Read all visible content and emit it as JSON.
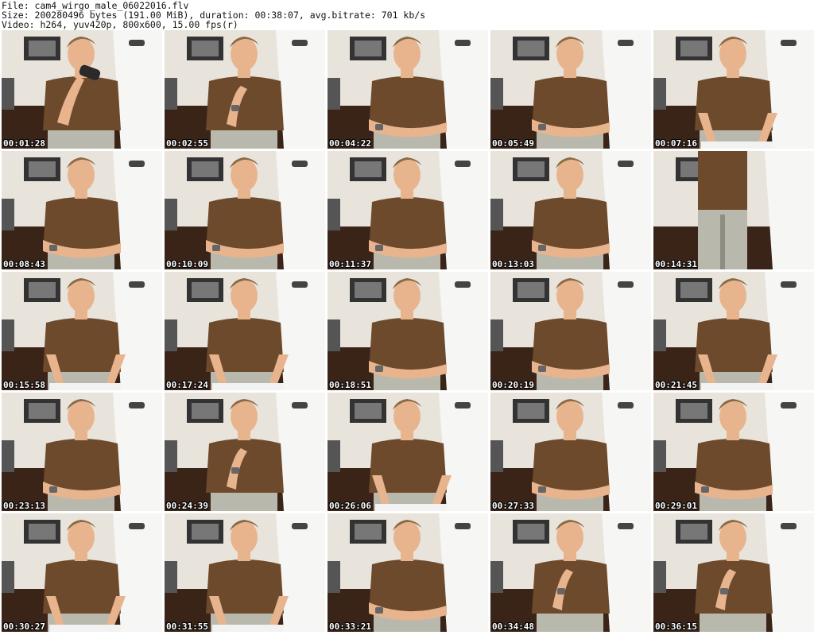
{
  "header": {
    "file_line": "File: cam4_wirgo_male_06022016.flv",
    "size_line": "Size: 200280496 bytes (191.00 MiB), duration: 00:38:07, avg.bitrate: 701 kb/s",
    "video_line": "Video: h264, yuv420p, 800x600, 15.00 fps(r)"
  },
  "colors": {
    "shirt": "#6e4a2c",
    "skin": "#e8b48e",
    "hair": "#8a6a44",
    "floor": "#3a2418",
    "wall": "#e8e4dc",
    "jeans": "#b9b8ad"
  },
  "thumbnails": [
    {
      "time": "00:01:28",
      "pose": "drinking"
    },
    {
      "time": "00:02:55",
      "pose": "hand-chin"
    },
    {
      "time": "00:04:22",
      "pose": "arms-crossed"
    },
    {
      "time": "00:05:49",
      "pose": "arms-crossed"
    },
    {
      "time": "00:07:16",
      "pose": "typing"
    },
    {
      "time": "00:08:43",
      "pose": "arms-crossed"
    },
    {
      "time": "00:10:09",
      "pose": "arms-crossed"
    },
    {
      "time": "00:11:37",
      "pose": "arms-crossed"
    },
    {
      "time": "00:13:03",
      "pose": "arms-crossed"
    },
    {
      "time": "00:14:31",
      "pose": "standing"
    },
    {
      "time": "00:15:58",
      "pose": "typing"
    },
    {
      "time": "00:17:24",
      "pose": "typing"
    },
    {
      "time": "00:18:51",
      "pose": "arms-crossed"
    },
    {
      "time": "00:20:19",
      "pose": "arms-crossed"
    },
    {
      "time": "00:21:45",
      "pose": "typing"
    },
    {
      "time": "00:23:13",
      "pose": "arms-crossed"
    },
    {
      "time": "00:24:39",
      "pose": "hand-chin"
    },
    {
      "time": "00:26:06",
      "pose": "typing"
    },
    {
      "time": "00:27:33",
      "pose": "arms-crossed"
    },
    {
      "time": "00:29:01",
      "pose": "arms-crossed"
    },
    {
      "time": "00:30:27",
      "pose": "typing"
    },
    {
      "time": "00:31:55",
      "pose": "typing"
    },
    {
      "time": "00:33:21",
      "pose": "arms-crossed"
    },
    {
      "time": "00:34:48",
      "pose": "hand-chin"
    },
    {
      "time": "00:36:15",
      "pose": "hand-chin"
    }
  ]
}
